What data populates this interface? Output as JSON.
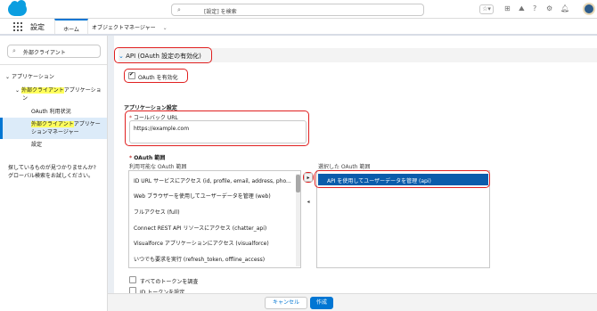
{
  "header": {
    "search_placeholder": "[設定] を検索"
  },
  "nav": {
    "app_title": "設定",
    "tabs": [
      {
        "label": "ホーム"
      },
      {
        "label": "オブジェクトマネージャー"
      }
    ]
  },
  "sidebar": {
    "quickfind_value": "外部クライアント",
    "section_label": "アプリケーション",
    "group_label_hl": "外部クライアント",
    "group_label_rest": "アプリケーショ",
    "group_label_wrap": "ン",
    "items": [
      {
        "label": "OAuth 利用状況"
      },
      {
        "label_hl": "外部クライアント",
        "label_rest": "アプリケー",
        "label_wrap": "ションマネージャー"
      },
      {
        "label": "設定"
      }
    ],
    "help_line1": "探しているものが見つかりませんか?",
    "help_line2": "グローバル検索をお試しください。"
  },
  "main": {
    "section_title": "API (OAuth 設定の有効化)",
    "enable_oauth_label": "OAuth を有効化",
    "app_settings_title": "アプリケーション設定",
    "callback_label": "コールバック URL",
    "callback_value": "https://example.com",
    "oauth_scopes_label": "OAuth 範囲",
    "available_label": "利用可能な OAuth 範囲",
    "selected_label": "選択した OAuth 範囲",
    "available_scopes": [
      "ID URL サービスにアクセス (id, profile, email, address, pho...",
      "Web ブラウザーを使用してユーザーデータを管理 (web)",
      "フルアクセス (full)",
      "Connect REST API リソースにアクセス (chatter_api)",
      "Visualforce アプリケーションにアクセス (visualforce)",
      "いつでも要求を実行 (refresh_token, offline_access)"
    ],
    "selected_scopes": [
      "API を使用してユーザーデータを管理 (api)"
    ],
    "add_arrow": "▸",
    "remove_arrow": "◂",
    "all_tokens_label": "すべてのトークンを調査",
    "id_token_label": "ID トークンを設定"
  },
  "footer": {
    "cancel_label": "キャンセル",
    "create_label": "作成"
  }
}
